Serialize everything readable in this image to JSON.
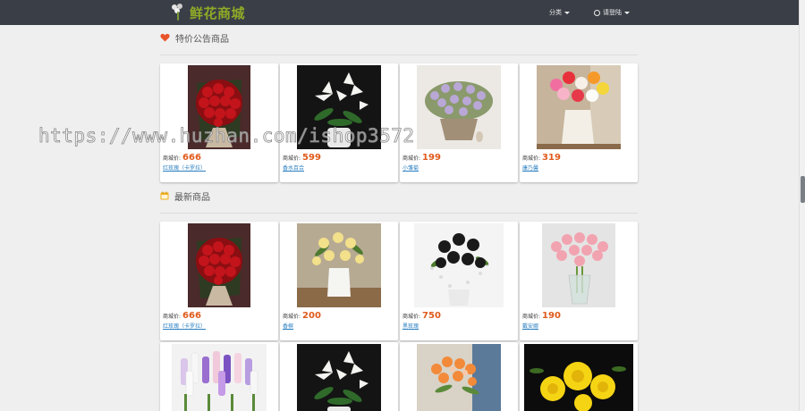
{
  "header": {
    "logo_text": "鲜花商城",
    "category_label": "分类",
    "login_label": "请登陆"
  },
  "sections": [
    {
      "title": "特价公告商品",
      "icon": "heart-icon",
      "products": [
        {
          "price_label": "商城价:",
          "price": "666",
          "name": "红玫瑰（卡罗拉）"
        },
        {
          "price_label": "商城价:",
          "price": "599",
          "name": "香水百合"
        },
        {
          "price_label": "商城价:",
          "price": "199",
          "name": "小雏菊"
        },
        {
          "price_label": "商城价:",
          "price": "319",
          "name": "康乃馨"
        }
      ]
    },
    {
      "title": "最新商品",
      "icon": "calendar-icon",
      "products": [
        {
          "price_label": "商城价:",
          "price": "666",
          "name": "红玫瑰（卡罗拉）"
        },
        {
          "price_label": "商城价:",
          "price": "200",
          "name": "香槟"
        },
        {
          "price_label": "商城价:",
          "price": "750",
          "name": "黑玫瑰"
        },
        {
          "price_label": "商城价:",
          "price": "190",
          "name": "戴安娜"
        }
      ]
    }
  ],
  "watermark": "https://www.huzhan.com/ishop3572",
  "colors": {
    "navbar": "#3a3f47",
    "logo": "#8faa27",
    "price": "#e05a1c",
    "link": "#2a7fc1",
    "heart": "#e8542a",
    "calendar": "#f0b020"
  }
}
